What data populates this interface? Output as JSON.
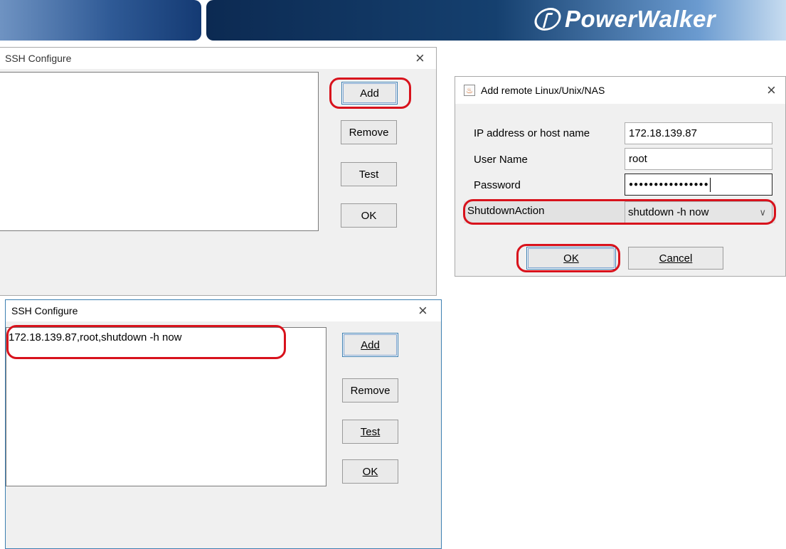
{
  "banner": {
    "brand": "PowerWalker"
  },
  "ssh_top": {
    "title": "SSH Configure",
    "close": "×",
    "buttons": {
      "add": "Add",
      "remove": "Remove",
      "test": "Test",
      "ok": "OK"
    }
  },
  "add_remote": {
    "title": "Add remote Linux/Unix/NAS",
    "close": "×",
    "labels": {
      "ip": "IP address or host name",
      "user": "User Name",
      "password": "Password",
      "shutdown": "ShutdownAction"
    },
    "values": {
      "ip": "172.18.139.87",
      "user": "root",
      "password": "●●●●●●●●●●●●●●●●",
      "shutdown": "shutdown -h now"
    },
    "buttons": {
      "ok": "OK",
      "cancel": "Cancel"
    }
  },
  "ssh_bottom": {
    "title": "SSH Configure",
    "close": "×",
    "list_items": [
      "172.18.139.87,root,shutdown -h now"
    ],
    "buttons": {
      "add": "Add",
      "remove": "Remove",
      "test": "Test",
      "ok": "OK"
    }
  },
  "colors": {
    "highlight": "#d8121c",
    "banner_dark": "#0c2a52"
  }
}
